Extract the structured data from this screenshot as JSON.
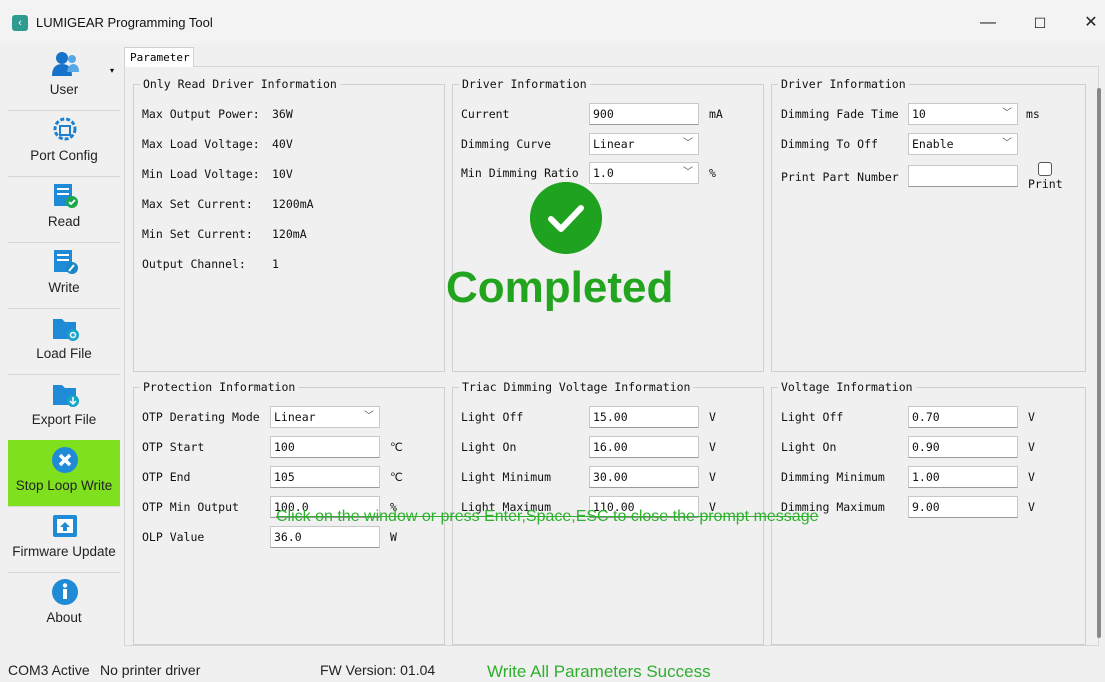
{
  "window": {
    "title": "LUMIGEAR Programming Tool",
    "app_icon": "lumigear-logo-icon",
    "controls": [
      "minimize-icon",
      "maximize-icon",
      "close-icon"
    ],
    "minimize_glyph": "—",
    "maximize_glyph": "☐",
    "close_glyph": "✕"
  },
  "sidebar": {
    "items": [
      {
        "label": "User",
        "icon": "user-icon"
      },
      {
        "label": "Port Config",
        "icon": "port-config-icon"
      },
      {
        "label": "Read",
        "icon": "read-icon"
      },
      {
        "label": "Write",
        "icon": "write-icon"
      },
      {
        "label": "Load File",
        "icon": "load-file-icon"
      },
      {
        "label": "Export File",
        "icon": "export-file-icon"
      },
      {
        "label": "Stop Loop Write",
        "icon": "stop-icon",
        "active": true,
        "active_color": "#7fe01d"
      },
      {
        "label": "Firmware Update",
        "icon": "firmware-update-icon"
      },
      {
        "label": "About",
        "icon": "info-icon"
      }
    ]
  },
  "tab": {
    "label": "Parameter"
  },
  "only_read": {
    "title": "Only Read Driver Information",
    "rows": [
      {
        "label": "Max Output Power:",
        "value": "36W"
      },
      {
        "label": "Max Load Voltage:",
        "value": "40V"
      },
      {
        "label": "Min Load Voltage:",
        "value": "10V"
      },
      {
        "label": "Max Set Current:",
        "value": "1200mA"
      },
      {
        "label": "Min Set Current:",
        "value": "120mA"
      },
      {
        "label": "Output Channel:",
        "value": "1"
      }
    ]
  },
  "driver_info_1": {
    "title": "Driver Information",
    "current_label": "Current",
    "current_value": "900",
    "current_unit": "mA",
    "curve_label": "Dimming Curve",
    "curve_value": "Linear",
    "ratio_label": "Min Dimming Ratio",
    "ratio_value": "1.0",
    "ratio_unit": "%"
  },
  "driver_info_2": {
    "title": "Driver Information",
    "fade_label": "Dimming Fade Time",
    "fade_value": "10",
    "fade_unit": "ms",
    "off_label": "Dimming To Off",
    "off_value": "Enable",
    "part_label": "Print Part Number",
    "part_value": "",
    "print_label": "Print"
  },
  "protection": {
    "title": "Protection Information",
    "rows": [
      {
        "label": "OTP Derating Mode",
        "value": "Linear",
        "unit": ""
      },
      {
        "label": "OTP Start",
        "value": "100",
        "unit": "℃"
      },
      {
        "label": "OTP End",
        "value": "105",
        "unit": "℃"
      },
      {
        "label": "OTP Min Output",
        "value": "100.0",
        "unit": "%"
      },
      {
        "label": "OLP Value",
        "value": "36.0",
        "unit": "W"
      }
    ]
  },
  "triac": {
    "title": "Triac Dimming Voltage Information",
    "rows": [
      {
        "label": "Light Off",
        "value": "15.00",
        "unit": "V"
      },
      {
        "label": "Light On",
        "value": "16.00",
        "unit": "V"
      },
      {
        "label": "Light Minimum",
        "value": "30.00",
        "unit": "V"
      },
      {
        "label": "Light Maximum",
        "value": "110.00",
        "unit": "V"
      }
    ]
  },
  "voltage": {
    "title": "Voltage Information",
    "rows": [
      {
        "label": "Light Off",
        "value": "0.70",
        "unit": "V"
      },
      {
        "label": "Light On",
        "value": "0.90",
        "unit": "V"
      },
      {
        "label": "Dimming Minimum",
        "value": "1.00",
        "unit": "V"
      },
      {
        "label": "Dimming Maximum",
        "value": "9.00",
        "unit": "V"
      }
    ]
  },
  "overlay": {
    "status": "Completed",
    "icon": "check-icon",
    "hint": "Click on the window or press Enter,Space,ESC to close the prompt message",
    "color": "#22a41e"
  },
  "statusbar": {
    "port": "COM3 Active",
    "printer": "No printer driver",
    "fw": "FW Version: 01.04",
    "message": "Write All Parameters Success"
  }
}
